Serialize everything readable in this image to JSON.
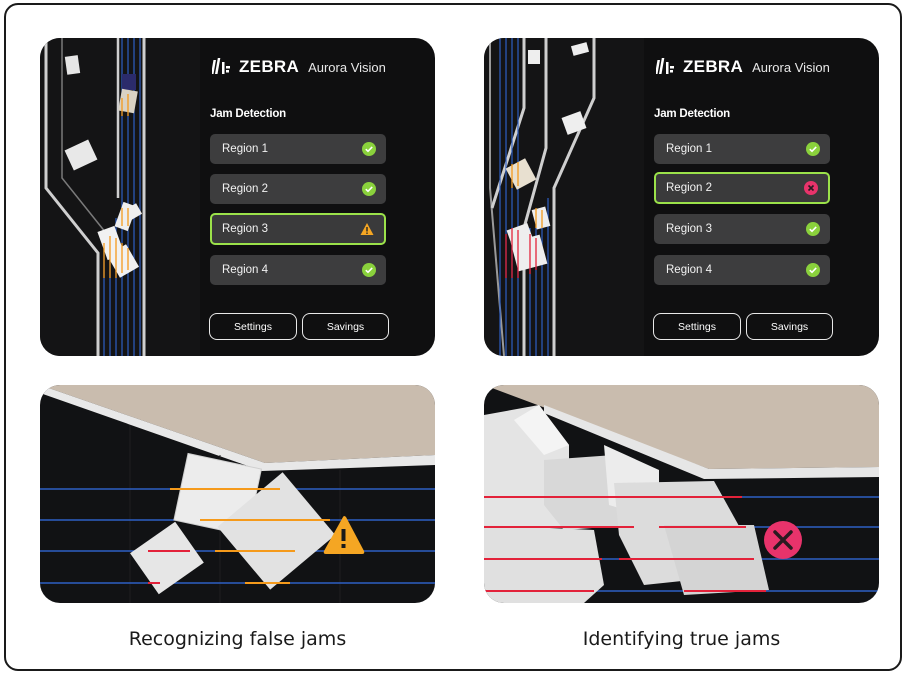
{
  "brand": {
    "name": "ZEBRA",
    "product": "Aurora Vision"
  },
  "panels": [
    {
      "section_title": "Jam Detection",
      "regions": [
        {
          "label": "Region 1",
          "status": "ok"
        },
        {
          "label": "Region 2",
          "status": "ok"
        },
        {
          "label": "Region 3",
          "status": "warning"
        },
        {
          "label": "Region 4",
          "status": "ok"
        }
      ],
      "buttons": {
        "settings": "Settings",
        "savings": "Savings"
      },
      "caption": "Recognizing false jams"
    },
    {
      "section_title": "Jam Detection",
      "regions": [
        {
          "label": "Region 1",
          "status": "ok"
        },
        {
          "label": "Region 2",
          "status": "error"
        },
        {
          "label": "Region 3",
          "status": "ok"
        },
        {
          "label": "Region 4",
          "status": "ok"
        }
      ],
      "buttons": {
        "settings": "Settings",
        "savings": "Savings"
      },
      "caption": "Identifying true jams"
    }
  ],
  "colors": {
    "ok": "#8ad13c",
    "warning": "#f5a623",
    "error": "#e8336b",
    "highlight_border": "#9be24a",
    "lane_line": "#2d5fc4",
    "amber_line": "#f59a1b",
    "red_line": "#e3223a"
  },
  "icons": {
    "ok": "check-circle-icon",
    "warning": "warning-triangle-icon",
    "error": "x-circle-icon"
  }
}
